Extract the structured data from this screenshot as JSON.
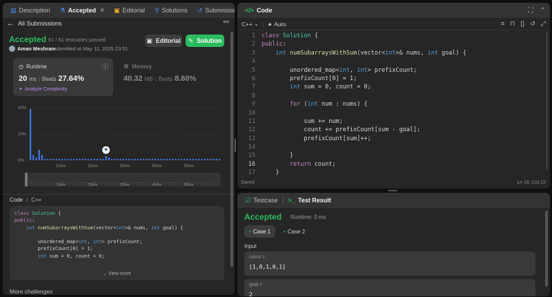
{
  "left_tabs": {
    "description": "Description",
    "accepted": "Accepted",
    "editorial": "Editorial",
    "solutions": "Solutions",
    "submissions": "Submissions",
    "close": "×"
  },
  "back": {
    "label": "All Submissions"
  },
  "status": {
    "title": "Accepted",
    "testcases": "61 / 61 testcases passed",
    "user": "Aman Meshram",
    "submitted": "submitted at May 11, 2025 23:51"
  },
  "buttons": {
    "editorial": "Editorial",
    "solution": "Solution"
  },
  "runtime": {
    "label": "Runtime",
    "value": "20",
    "unit": "ms",
    "beats_label": "Beats",
    "beats": "27.64%",
    "analyze": "Analyze Complexity"
  },
  "memory": {
    "label": "Memory",
    "value": "40.32",
    "unit": "MB",
    "beats_label": "Beats",
    "beats": "8.60%"
  },
  "chart_data": {
    "type": "bar",
    "yticks": [
      "40%",
      "20%",
      "0%"
    ],
    "xticks": [
      "10ms",
      "20ms",
      "30ms",
      "40ms",
      "50ms"
    ],
    "values": [
      39,
      4,
      2,
      8,
      4,
      1,
      1,
      1,
      1,
      1,
      1,
      1,
      1,
      1,
      1,
      1,
      1,
      1,
      1,
      1,
      1,
      1,
      1,
      1,
      1,
      1,
      3,
      2,
      1,
      1,
      1,
      1,
      1,
      1,
      1,
      1,
      1,
      1,
      1,
      1,
      1,
      1,
      1,
      1,
      1,
      1,
      1,
      1,
      1,
      1,
      1,
      1,
      1,
      1,
      1,
      1,
      1,
      1,
      1,
      1,
      1,
      1,
      1,
      1,
      1,
      1
    ],
    "highlight_index": 26,
    "ylim": [
      0,
      42
    ],
    "colors": {
      "bar": "#3f7df0",
      "highlight": "#ffffff"
    }
  },
  "code_section": {
    "label": "Code",
    "lang": "C++",
    "view_more": "View more"
  },
  "more_challenges": "More challenges",
  "editor": {
    "title": "Code",
    "lang": "C++",
    "mode": "Auto",
    "saved": "Saved",
    "cursor": "Ln 16, Col 22"
  },
  "preview_lines": [
    "class Solution {",
    "public:",
    "    int numSubarraysWithSum(vector<int>& nums, int goal) {",
    "",
    "        unordered_map<int, int> prefixCount;",
    "        prefixCount[0] = 1;",
    "        int sum = 0, count = 0;"
  ],
  "code_lines": [
    "class Solution {",
    "public:",
    "    int numSubarraysWithSum(vector<int>& nums, int goal) {",
    "",
    "        unordered_map<int, int> prefixCount;",
    "        prefixCount[0] = 1;",
    "        int sum = 0, count = 0;",
    "",
    "        for (int num : nums) {",
    "",
    "            sum += num;",
    "            count += prefixCount[sum - goal];",
    "            prefixCount[sum]++;",
    "",
    "        }",
    "        return count;",
    "    }"
  ],
  "line_numbers": [
    "1",
    "2",
    "3",
    "4",
    "5",
    "6",
    "7",
    "8",
    "9",
    "10",
    "11",
    "12",
    "13",
    "14",
    "15",
    "16",
    "17"
  ],
  "test": {
    "tab_testcase": "Testcase",
    "tab_result": "Test Result",
    "status": "Accepted",
    "runtime": "Runtime: 0 ms",
    "case1": "Case 1",
    "case2": "Case 2",
    "input_label": "Input",
    "nums_label": "nums =",
    "nums_value": "[1,0,1,0,1]",
    "goal_label": "goal =",
    "goal_value": "2"
  }
}
